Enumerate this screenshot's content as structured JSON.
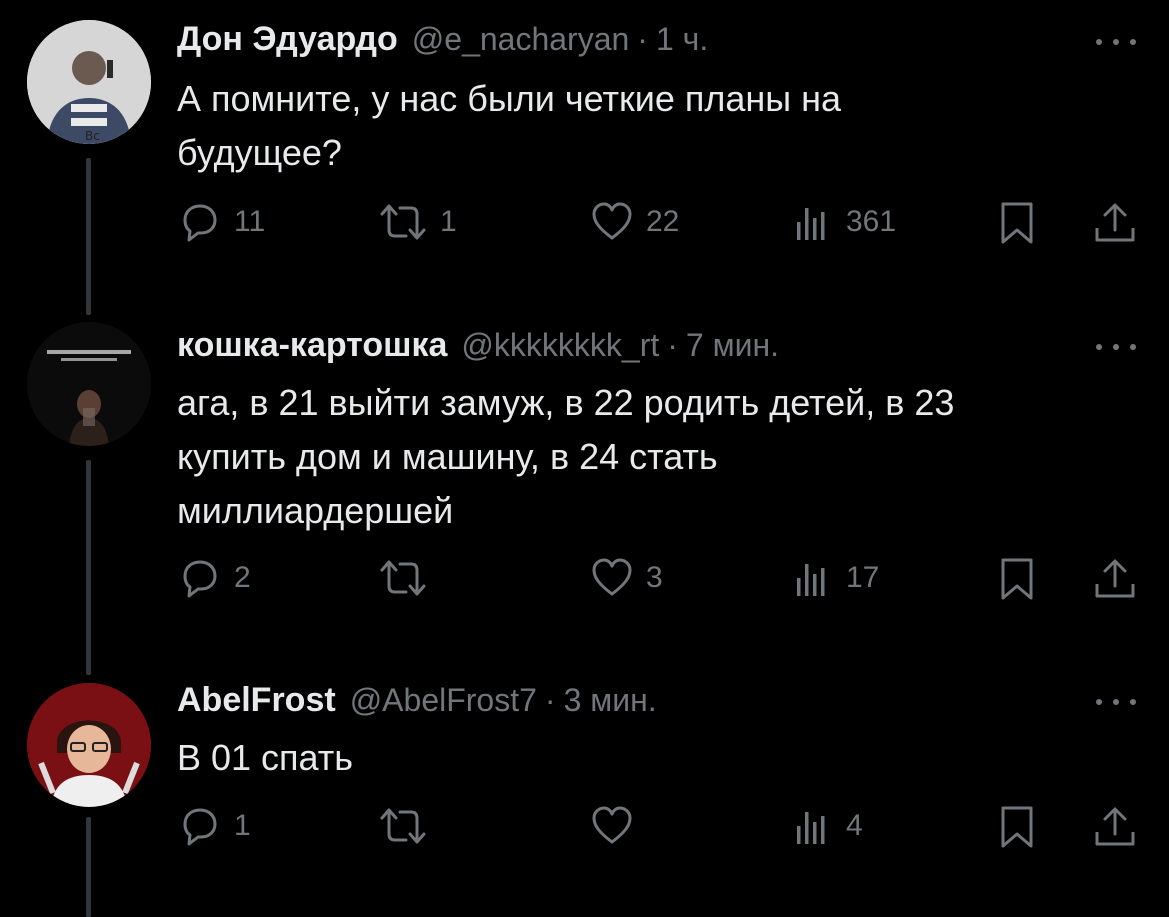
{
  "tweets": [
    {
      "author": "Дон Эдуардо",
      "handle": "@e_nacharyan",
      "separator": "·",
      "time": "1 ч.",
      "text_lines": [
        "А помните, у нас были четкие планы на",
        "будущее?"
      ],
      "counts": {
        "replies": "11",
        "retweets": "1",
        "likes": "22",
        "views": "361"
      },
      "avatar_colors": {
        "bg": "#d8d8d8",
        "figure": "#6b6f78"
      }
    },
    {
      "author": "кошка-картошка",
      "handle": "@kkkkkkkk_rt",
      "separator": "·",
      "time": "7 мин.",
      "text_lines": [
        "ага, в 21 выйти замуж, в 22 родить детей, в 23",
        "купить дом и машину, в 24 стать",
        "миллиардершей"
      ],
      "counts": {
        "replies": "2",
        "retweets": "",
        "likes": "3",
        "views": "17"
      },
      "avatar_colors": {
        "bg": "#0d0d0d",
        "figure": "#3a2a24"
      }
    },
    {
      "author": "AbelFrost",
      "handle": "@AbelFrost7",
      "separator": "·",
      "time": "3 мин.",
      "text_lines": [
        "В 01 спать"
      ],
      "counts": {
        "replies": "1",
        "retweets": "",
        "likes": "",
        "views": "4"
      },
      "avatar_colors": {
        "bg": "#7a0f12",
        "figure": "#e9e9e9"
      }
    }
  ],
  "icons": {
    "reply": "reply-icon",
    "retweet": "retweet-icon",
    "like": "heart-icon",
    "views": "views-icon",
    "bookmark": "bookmark-icon",
    "share": "share-icon",
    "more": "more-icon"
  },
  "colors": {
    "background": "#000000",
    "text": "#e7e9ea",
    "secondary": "#71767b",
    "thread_line": "#333639"
  }
}
